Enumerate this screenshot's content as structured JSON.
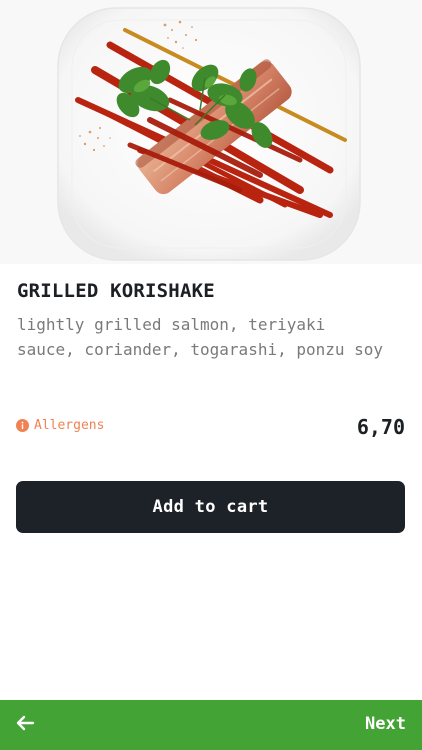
{
  "product": {
    "image_alt": "Grilled korishake dish photo",
    "name": "GRILLED KORISHAKE",
    "description": "lightly grilled salmon, teriyaki sauce, coriander, togarashi, ponzu soy",
    "allergens_label": "Allergens",
    "price": "6,70"
  },
  "actions": {
    "add_to_cart_label": "Add to cart"
  },
  "nav": {
    "back_icon": "arrow-left-icon",
    "next_label": "Next"
  },
  "colors": {
    "accent_green": "#43a334",
    "button_dark": "#1d2128",
    "allergen_orange": "#ef8354"
  }
}
